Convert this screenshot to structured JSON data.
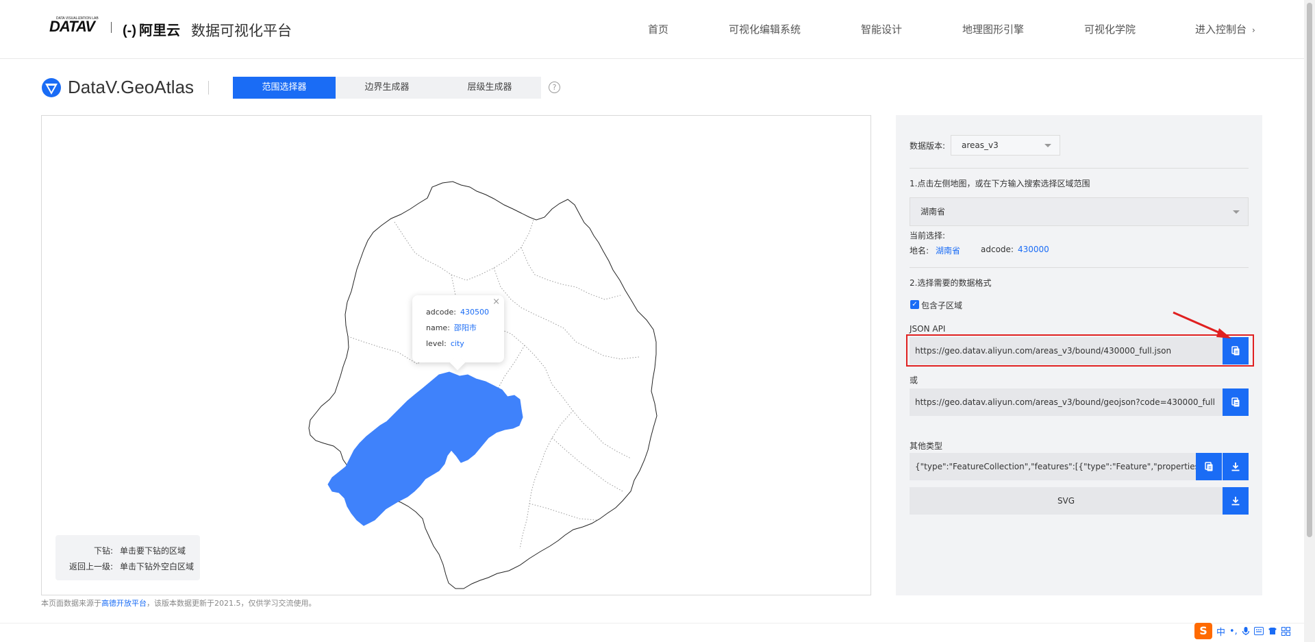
{
  "header": {
    "logo_datav": "DATAV",
    "logo_datav_sub": "DATA VISUALIZATION LAB",
    "logo_aliyun_bracket": "(-)",
    "logo_aliyun": "阿里云",
    "platform_title": "数据可视化平台",
    "nav": [
      "首页",
      "可视化编辑系统",
      "智能设计",
      "地理图形引擎",
      "可视化学院",
      "进入控制台"
    ],
    "nav_chevron": "›"
  },
  "subheader": {
    "brand": "DataV.GeoAtlas",
    "tabs": [
      "范围选择器",
      "边界生成器",
      "层级生成器"
    ],
    "active_tab": 0,
    "help": "?"
  },
  "map": {
    "tooltip": {
      "adcode_label": "adcode:",
      "adcode": "430500",
      "name_label": "name:",
      "name": "邵阳市",
      "level_label": "level:",
      "level": "city",
      "close": "×"
    },
    "legend": [
      {
        "key": "下钻:",
        "value": "单击要下钻的区域"
      },
      {
        "key": "返回上一级:",
        "value": "单击下钻外空白区域"
      }
    ],
    "highlight_color": "#3f82fb"
  },
  "footnote": {
    "prefix": "本页面数据来源于",
    "link": "高德开放平台",
    "suffix": "，该版本数据更新于2021.5，仅供学习交流使用。"
  },
  "side": {
    "version_label": "数据版本:",
    "version_value": "areas_v3",
    "step1": "1.点击左侧地图，或在下方输入搜索选择区域范围",
    "region_value": "湖南省",
    "current_label": "当前选择:",
    "name_label": "地名:",
    "name_value": "湖南省",
    "adcode_label": "adcode:",
    "adcode_value": "430000",
    "step2": "2.选择需要的数据格式",
    "include_children": "包含子区域",
    "json_api_label": "JSON API",
    "json_api_url": "https://geo.datav.aliyun.com/areas_v3/bound/430000_full.json",
    "or_label": "或",
    "geojson_url": "https://geo.datav.aliyun.com/areas_v3/bound/geojson?code=430000_full",
    "other_label": "其他类型",
    "other_value": "{\"type\":\"FeatureCollection\",\"features\":[{\"type\":\"Feature\",\"properties\":{\"a",
    "svg_label": "SVG"
  },
  "ime": {
    "logo": "S",
    "lang": "中",
    "punct": "•,"
  },
  "colors": {
    "accent": "#1a6cf5",
    "highlight_box": "#e02020"
  }
}
